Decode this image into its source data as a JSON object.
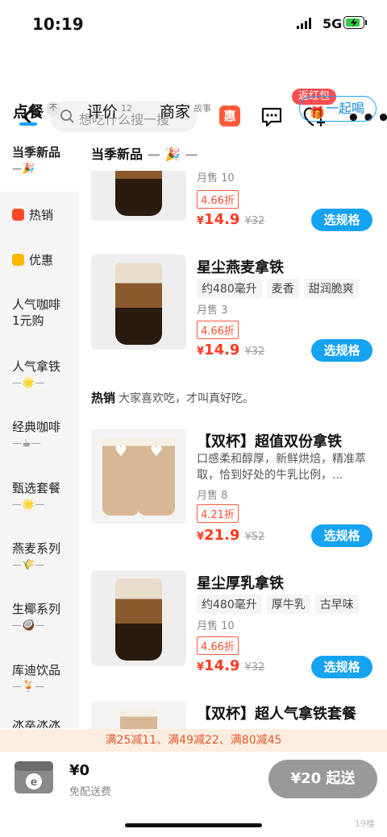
{
  "status": {
    "time": "10:19",
    "network": "5G"
  },
  "nav": {
    "search_placeholder": "想吃什么搜一搜",
    "hui": "惠",
    "badge": "返红包"
  },
  "tabs": [
    {
      "label": "点餐",
      "extra": "不"
    },
    {
      "label": "评价",
      "extra": "12"
    },
    {
      "label": "商家",
      "extra": "故事"
    }
  ],
  "together": "一起喝",
  "sidebar": [
    {
      "label": "当季新品",
      "emoji": "🎉"
    },
    {
      "label": "热销"
    },
    {
      "label": "优惠"
    },
    {
      "label": "人气咖啡1元购"
    },
    {
      "label": "人气拿铁",
      "emoji": "🌟"
    },
    {
      "label": "经典咖啡",
      "emoji": "☕"
    },
    {
      "label": "甄选套餐",
      "emoji": "🌟"
    },
    {
      "label": "燕麦系列",
      "emoji": "🌾"
    },
    {
      "label": "生椰系列",
      "emoji": "🥥"
    },
    {
      "label": "库迪饮品",
      "emoji": "🍹"
    },
    {
      "label": "冰萃冰冰"
    }
  ],
  "main": {
    "section_title": "当季新品",
    "section_emoji": "🎉",
    "hot_title": "热销",
    "hot_sub": "大家喜欢吃，才叫真好吃。"
  },
  "products": [
    {
      "title": "",
      "tags": [],
      "desc": "",
      "sales": "月售 10",
      "discount": "4.66折",
      "price": "14.9",
      "orig": "¥32",
      "button": "选规格"
    },
    {
      "title": "星尘燕麦拿铁",
      "tags": [
        "约480毫升",
        "麦香",
        "甜润脆爽"
      ],
      "desc": "",
      "sales": "月售 3",
      "discount": "4.66折",
      "price": "14.9",
      "orig": "¥32",
      "button": "选规格"
    },
    {
      "title": "【双杯】超值双份拿铁",
      "tags": [],
      "desc": "口感柔和醇厚，新鲜烘焙，精准萃取，恰到好处的牛乳比例，...",
      "sales": "月售 8",
      "discount": "4.21折",
      "price": "21.9",
      "orig": "¥52",
      "button": "选规格"
    },
    {
      "title": "星尘厚乳拿铁",
      "tags": [
        "约480毫升",
        "厚牛乳",
        "古早味"
      ],
      "desc": "",
      "sales": "月售 10",
      "discount": "4.66折",
      "price": "14.9",
      "orig": "¥32",
      "button": "选规格"
    },
    {
      "title": "【双杯】超人气拿铁套餐",
      "tags": [],
      "desc": "",
      "sales": "",
      "discount": "",
      "price": "",
      "orig": "",
      "button": ""
    }
  ],
  "promo": "满25减11、满49减22、满80减45",
  "footer": {
    "amount": "¥0",
    "fee": "免配送费",
    "min": "¥20 起送"
  },
  "watermark": "19楼"
}
